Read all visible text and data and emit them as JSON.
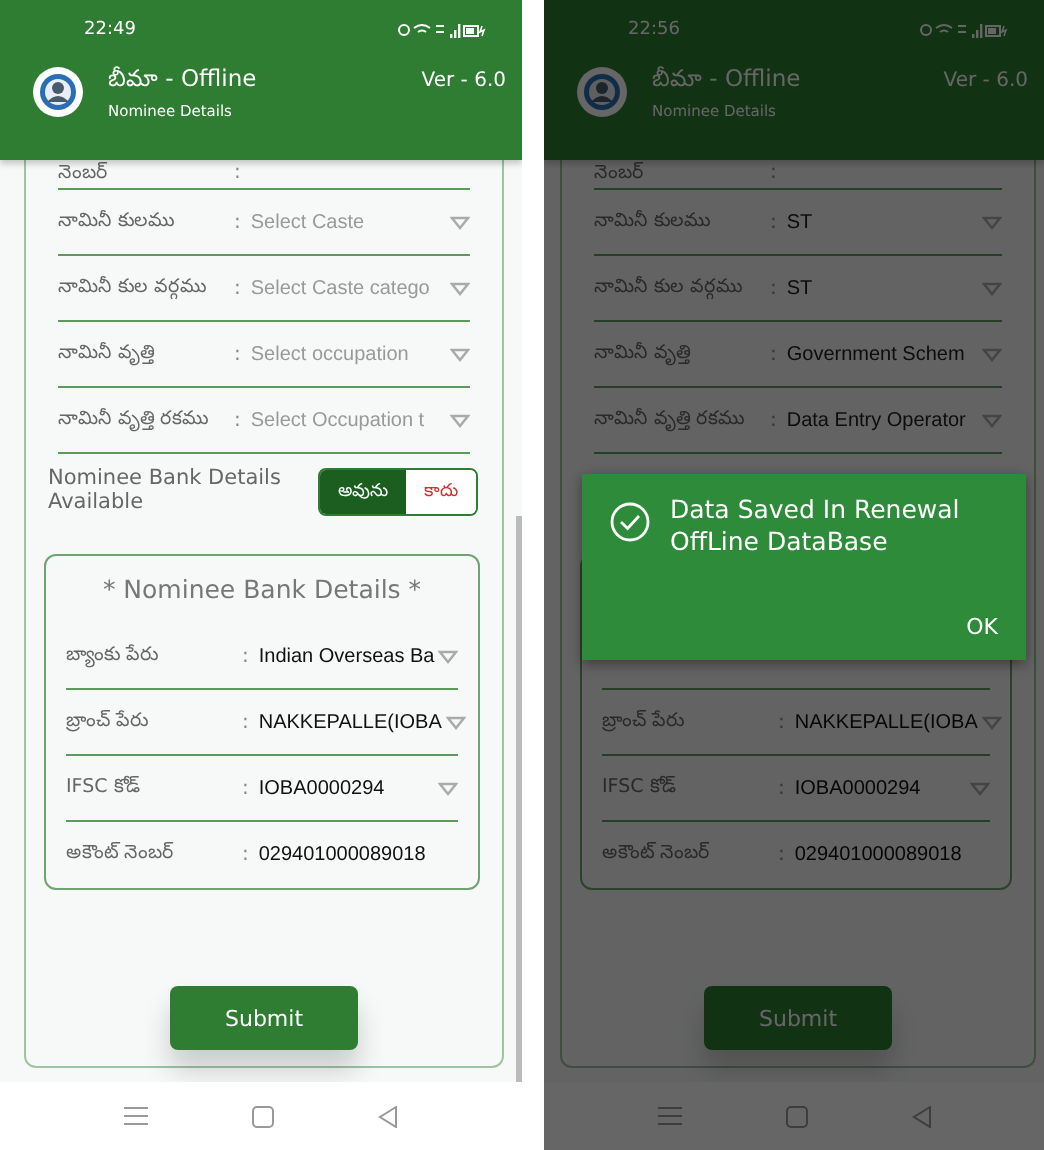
{
  "screens": [
    {
      "status_time": "22:49",
      "app_title": "బీమా - Offline",
      "subtitle": "Nominee Details",
      "version": "Ver - 6.0",
      "dimmed": false,
      "rows": [
        {
          "kind": "text",
          "label": "నెంబర్",
          "colon": ":"
        },
        {
          "kind": "dropdown",
          "label": "నామినీ కులము",
          "colon": ":",
          "placeholder": "Select Caste"
        },
        {
          "kind": "dropdown",
          "label": "నామినీ కుల వర్గము",
          "colon": ":",
          "placeholder": "Select Caste catego"
        },
        {
          "kind": "dropdown",
          "label": "నామినీ వృత్తి",
          "colon": ":",
          "placeholder": "Select occupation"
        },
        {
          "kind": "dropdown",
          "label": "నామినీ వృత్తి రకము",
          "colon": ":",
          "placeholder": "Select Occupation t"
        }
      ],
      "bank_toggle": {
        "label": "Nominee Bank Details Available",
        "options": [
          {
            "label": "అవును",
            "selected": true
          },
          {
            "label": "కాదు",
            "selected": false
          }
        ]
      },
      "bank_title": "* Nominee Bank Details *",
      "bank_rows": [
        {
          "kind": "dropdown",
          "label": "బ్యాంకు పేరు",
          "colon": ":",
          "value": "Indian Overseas Ba"
        },
        {
          "kind": "dropdown",
          "label": "బ్రాంచ్ పేరు",
          "colon": ":",
          "value": "NAKKEPALLE(IOBA"
        },
        {
          "kind": "dropdown",
          "label": "IFSC కోడ్",
          "colon": ":",
          "value": "IOBA0000294"
        },
        {
          "kind": "text",
          "label": "అకౌంట్ నెంబర్",
          "colon": ":",
          "value": "029401000089018"
        }
      ],
      "submit": "Submit"
    },
    {
      "status_time": "22:56",
      "app_title": "బీమా - Offline",
      "subtitle": "Nominee Details",
      "version": "Ver - 6.0",
      "dimmed": true,
      "rows": [
        {
          "kind": "text",
          "label": "నెంబర్",
          "colon": ":"
        },
        {
          "kind": "dropdown",
          "label": "నామినీ కులము",
          "colon": ":",
          "value": "ST"
        },
        {
          "kind": "dropdown",
          "label": "నామినీ కుల వర్గము",
          "colon": ":",
          "value": "ST"
        },
        {
          "kind": "dropdown",
          "label": "నామినీ వృత్తి",
          "colon": ":",
          "value": "Government Schem"
        },
        {
          "kind": "dropdown",
          "label": "నామినీ వృత్తి రకము",
          "colon": ":",
          "value": "Data Entry Operator"
        }
      ],
      "bank_rows": [
        {
          "kind": "dropdown",
          "label": "బ్రాంచ్ పేరు",
          "colon": ":",
          "value": "NAKKEPALLE(IOBA"
        },
        {
          "kind": "dropdown",
          "label": "IFSC కోడ్",
          "colon": ":",
          "value": "IOBA0000294"
        },
        {
          "kind": "text",
          "label": "అకౌంట్ నెంబర్",
          "colon": ":",
          "value": "029401000089018"
        }
      ],
      "submit": "Submit",
      "dialog": {
        "message": "Data Saved In Renewal OffLine DataBase",
        "button": "OK"
      }
    }
  ]
}
